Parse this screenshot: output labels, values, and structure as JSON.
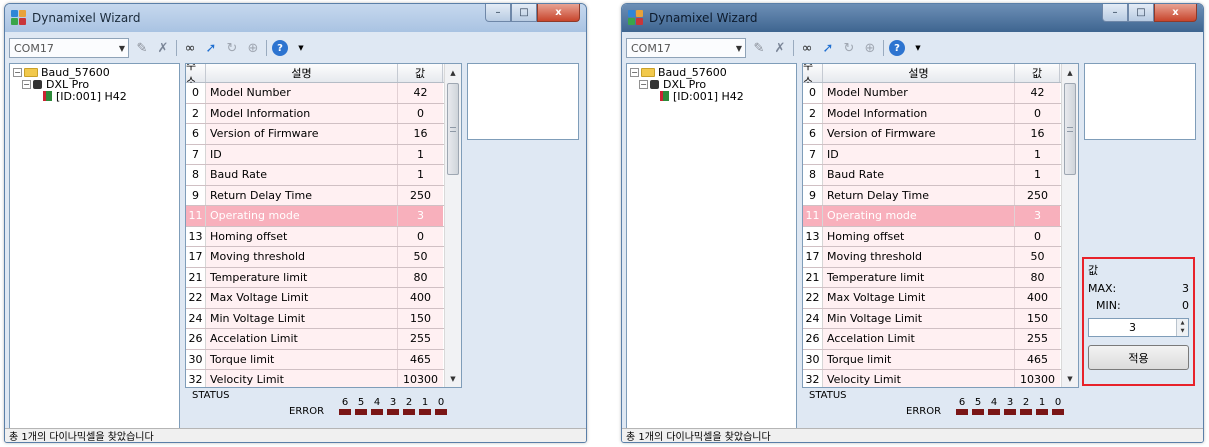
{
  "app": {
    "title": "Dynamixel Wizard",
    "min_glyph": "–",
    "max_glyph": "□",
    "close_glyph": "x"
  },
  "toolbar": {
    "port": "COM17",
    "icons": [
      "pencil-icon",
      "unplug-icon",
      "search-icon",
      "upload-icon",
      "refresh-icon",
      "network-icon",
      "help-icon"
    ]
  },
  "tree": {
    "root": "Baud_57600",
    "model": "DXL Pro",
    "device": "[ID:001] H42"
  },
  "grid": {
    "headers": {
      "address": "주소",
      "description": "설명",
      "value": "값"
    },
    "rows": [
      {
        "addr": "0",
        "name": "Model Number",
        "value": "42"
      },
      {
        "addr": "2",
        "name": "Model Information",
        "value": "0"
      },
      {
        "addr": "6",
        "name": "Version of Firmware",
        "value": "16"
      },
      {
        "addr": "7",
        "name": "ID",
        "value": "1"
      },
      {
        "addr": "8",
        "name": "Baud Rate",
        "value": "1"
      },
      {
        "addr": "9",
        "name": "Return Delay Time",
        "value": "250"
      },
      {
        "addr": "11",
        "name": "Operating mode",
        "value": "3",
        "selected": true
      },
      {
        "addr": "13",
        "name": "Homing offset",
        "value": "0"
      },
      {
        "addr": "17",
        "name": "Moving threshold",
        "value": "50"
      },
      {
        "addr": "21",
        "name": "Temperature limit",
        "value": "80"
      },
      {
        "addr": "22",
        "name": "Max Voltage Limit",
        "value": "400"
      },
      {
        "addr": "24",
        "name": "Min Voltage Limit",
        "value": "150"
      },
      {
        "addr": "26",
        "name": "Accelation Limit",
        "value": "255"
      },
      {
        "addr": "30",
        "name": "Torque limit",
        "value": "465"
      },
      {
        "addr": "32",
        "name": "Velocity Limit",
        "value": "10300"
      }
    ]
  },
  "status": {
    "label": "STATUS",
    "error_label": "ERROR",
    "bits": [
      "6",
      "5",
      "4",
      "3",
      "2",
      "1",
      "0"
    ]
  },
  "statusbar": {
    "text": "총 1개의 다이나믹셀을 찾았습니다"
  },
  "editor": {
    "value_label": "값",
    "max_label": "MAX:",
    "max_value": "3",
    "min_label": "MIN:",
    "min_value": "0",
    "current": "3",
    "apply_label": "적용"
  },
  "colors": {
    "row_bg": "#fff0f2",
    "selected_row": "#f8b0bc",
    "error_led": "#7a1616",
    "highlight_box": "#e8222a"
  }
}
